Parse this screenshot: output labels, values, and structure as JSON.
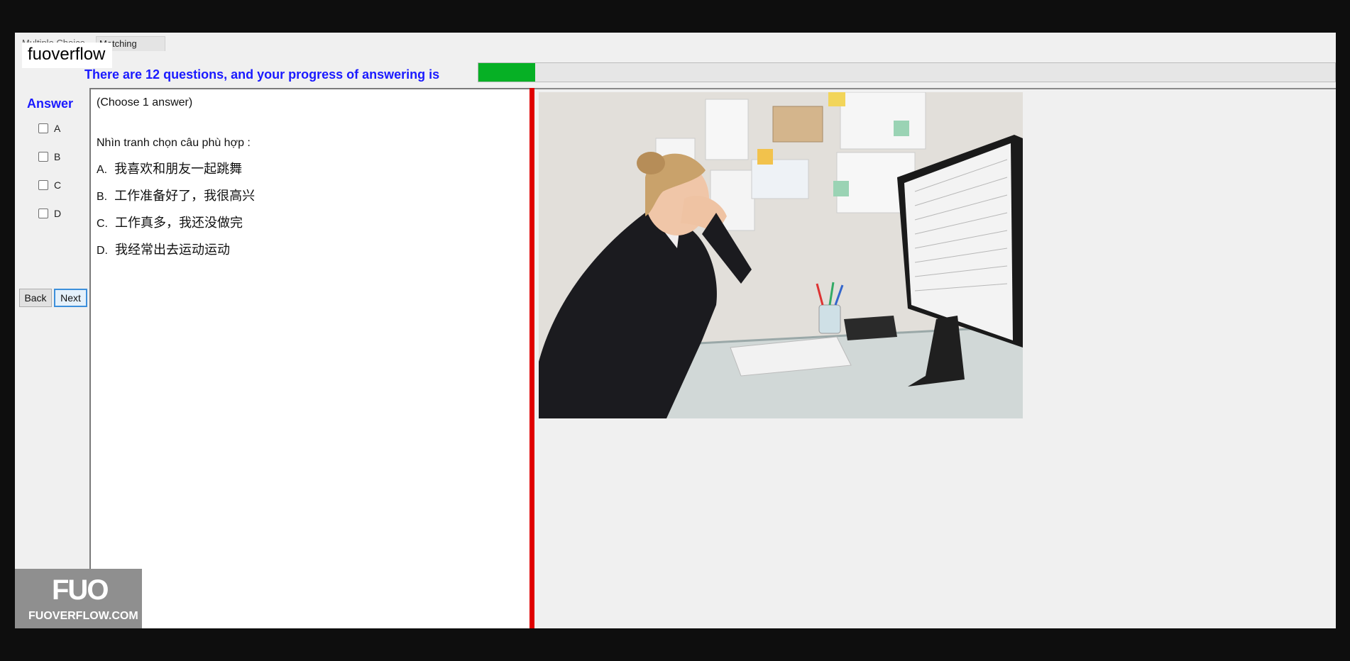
{
  "tabs": [
    "Multiple Choice",
    "Matching"
  ],
  "watermark": "fuoverflow",
  "progress": {
    "text": "There are 12 questions, and your progress of answering is",
    "fraction": 0.066
  },
  "answer_panel": {
    "heading": "Answer",
    "options": [
      "A",
      "B",
      "C",
      "D"
    ],
    "back_label": "Back",
    "next_label": "Next"
  },
  "question": {
    "instruction": "(Choose 1 answer)",
    "prompt": "Nhìn tranh chọn câu phù hợp :",
    "choices": [
      {
        "letter": "A.",
        "text": "我喜欢和朋友一起跳舞"
      },
      {
        "letter": "B.",
        "text": "工作准备好了，我很高兴"
      },
      {
        "letter": "C.",
        "text": "工作真多，我还没做完"
      },
      {
        "letter": "D.",
        "text": "我经常出去运动运动"
      }
    ]
  },
  "image": {
    "description_icon": "stressed-office-worker-photo"
  },
  "logo": {
    "mark": "FUO",
    "site": "FUOVERFLOW.COM"
  },
  "colors": {
    "accent_blue": "#1a1aff",
    "progress_green": "#06b025",
    "divider_red": "#e00000"
  }
}
